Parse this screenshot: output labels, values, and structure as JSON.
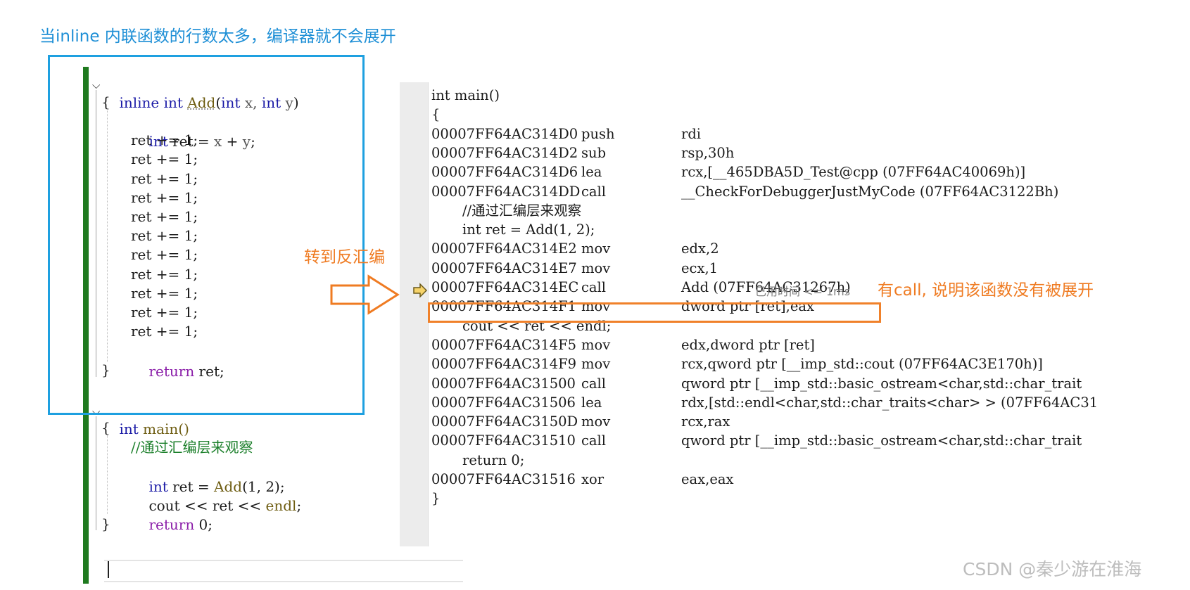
{
  "heading": "当inline 内联函数的行数太多，编译器就不会展开",
  "goto_label": "转到反汇编",
  "call_note": "有call, 说明该函数没有被展开",
  "elapsed": "已用时间 <= 1ms",
  "watermark": "CSDN @秦少游在淮海",
  "editor": {
    "add_sig": {
      "kw1": "inline",
      "kw2": "int",
      "name": "Add",
      "open": "(",
      "t1": "int",
      "p1": " x, ",
      "t2": "int",
      "p2": " y",
      "close": ")"
    },
    "brace_open": "{",
    "brace_close": "}",
    "decl": {
      "kw": "int",
      "rest": " ret = ",
      "x": "x",
      "plus": " + ",
      "y": "y",
      "semi": ";"
    },
    "inc_line": "ret += 1;",
    "ret_line": {
      "kw": "return",
      "rest": " ret;"
    },
    "main_sig": {
      "kw": "int",
      "name": " main()"
    },
    "comment": "//通过汇编层来观察",
    "call_line": {
      "kw": "int",
      "rest": " ret = ",
      "fn": "Add",
      "args": "(1, 2);"
    },
    "cout_line": {
      "a": "cout ",
      "op1": "<<",
      "b": " ret ",
      "op2": "<<",
      "c": " endl",
      "semi": ";"
    },
    "return0": {
      "kw": "return",
      "rest": " 0;"
    }
  },
  "disasm": {
    "header": "int main()",
    "brace_open": "{",
    "brace_close": "}",
    "rows": [
      {
        "addr": "00007FF64AC314D0",
        "op": "push",
        "arg": "rdi"
      },
      {
        "addr": "00007FF64AC314D2",
        "op": "sub",
        "arg": "rsp,30h"
      },
      {
        "addr": "00007FF64AC314D6",
        "op": "lea",
        "arg": "rcx,[__465DBA5D_Test@cpp (07FF64AC40069h)]"
      },
      {
        "addr": "00007FF64AC314DD",
        "op": "call",
        "arg": "__CheckForDebuggerJustMyCode (07FF64AC3122Bh)"
      },
      {
        "src": "//通过汇编层来观察"
      },
      {
        "src": "int ret = Add(1, 2);"
      },
      {
        "addr": "00007FF64AC314E2",
        "op": "mov",
        "arg": "edx,2"
      },
      {
        "addr": "00007FF64AC314E7",
        "op": "mov",
        "arg": "ecx,1"
      },
      {
        "addr": "00007FF64AC314EC",
        "op": "call",
        "arg": "Add (07FF64AC31267h)"
      },
      {
        "addr": "00007FF64AC314F1",
        "op": "mov",
        "arg": "dword ptr [ret],eax"
      },
      {
        "src": "cout << ret << endl;"
      },
      {
        "addr": "00007FF64AC314F5",
        "op": "mov",
        "arg": "edx,dword ptr [ret]"
      },
      {
        "addr": "00007FF64AC314F9",
        "op": "mov",
        "arg": "rcx,qword ptr [__imp_std::cout (07FF64AC3E170h)]"
      },
      {
        "addr": "00007FF64AC31500",
        "op": "call",
        "arg": "qword ptr [__imp_std::basic_ostream<char,std::char_trait"
      },
      {
        "addr": "00007FF64AC31506",
        "op": "lea",
        "arg": "rdx,[std::endl<char,std::char_traits<char> > (07FF64AC31"
      },
      {
        "addr": "00007FF64AC3150D",
        "op": "mov",
        "arg": "rcx,rax"
      },
      {
        "addr": "00007FF64AC31510",
        "op": "call",
        "arg": "qword ptr [__imp_std::basic_ostream<char,std::char_trait"
      },
      {
        "src": "return 0;"
      },
      {
        "addr": "00007FF64AC31516",
        "op": "xor",
        "arg": "eax,eax"
      }
    ]
  },
  "colors": {
    "keyword": "#1a1aa6",
    "control": "#8b1fa9",
    "comment": "#1b7f2a",
    "annotation": "#ef7b22",
    "box_blue": "#1ea0e0"
  }
}
